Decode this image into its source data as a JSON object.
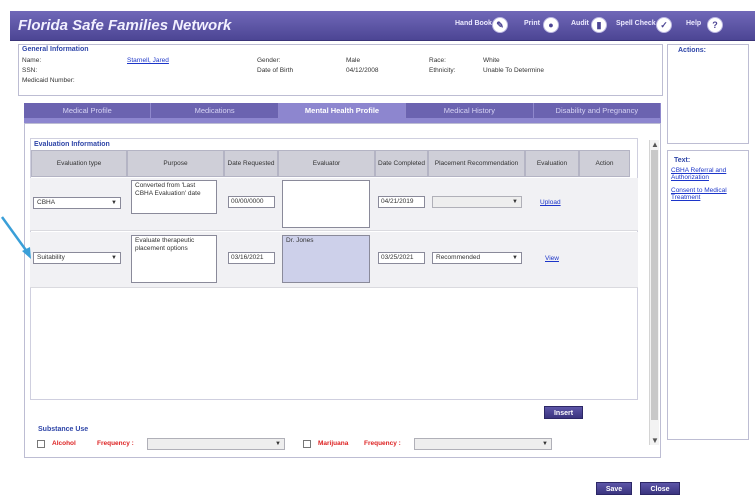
{
  "app": {
    "title": "Florida Safe Families Network"
  },
  "toolbar": {
    "hand_book": "Hand Book",
    "print": "Print",
    "audit": "Audit",
    "spell_check": "Spell Check",
    "help": "Help"
  },
  "general": {
    "heading": "General Information",
    "name_label": "Name:",
    "name_value": "Starnell, Jared",
    "ssn_label": "SSN:",
    "medicaid_label": "Medicaid Number:",
    "gender_label": "Gender:",
    "gender_value": "Male",
    "dob_label": "Date of Birth",
    "dob_value": "04/12/2008",
    "race_label": "Race:",
    "race_value": "White",
    "ethnicity_label": "Ethnicity:",
    "ethnicity_value": "Unable To Determine"
  },
  "actions_panel": {
    "heading": "Actions:"
  },
  "text_panel": {
    "heading": "Text:",
    "link1": "CBHA Referral and Authorization",
    "link2": "Consent to Medical Treatment"
  },
  "tabs": [
    {
      "label": "Medical Profile"
    },
    {
      "label": "Medications"
    },
    {
      "label": "Mental Health Profile"
    },
    {
      "label": "Medical History"
    },
    {
      "label": "Disability and Pregnancy"
    }
  ],
  "evaluation": {
    "heading": "Evaluation Information",
    "columns": {
      "type": "Evaluation type",
      "purpose": "Purpose",
      "date_requested": "Date Requested",
      "evaluator": "Evaluator",
      "date_completed": "Date Completed",
      "placement": "Placement Recommendation",
      "evaluation": "Evaluation",
      "action": "Action"
    },
    "rows": [
      {
        "type": "CBHA",
        "purpose": "Converted from 'Last CBHA Evaluation' date",
        "date_requested": "00/00/0000",
        "evaluator": "",
        "date_completed": "04/21/2019",
        "placement": "",
        "link": "Upload"
      },
      {
        "type": "Suitability",
        "purpose": "Evaluate therapeutic placement options",
        "date_requested": "03/16/2021",
        "evaluator": "Dr. Jones",
        "date_completed": "03/25/2021",
        "placement": "Recommended",
        "link": "View"
      }
    ],
    "insert_label": "Insert"
  },
  "substance": {
    "heading": "Substance Use",
    "alcohol": "Alcohol",
    "marijuana": "Marijuana",
    "frequency": "Frequency :"
  },
  "footer": {
    "save": "Save",
    "close": "Close"
  }
}
